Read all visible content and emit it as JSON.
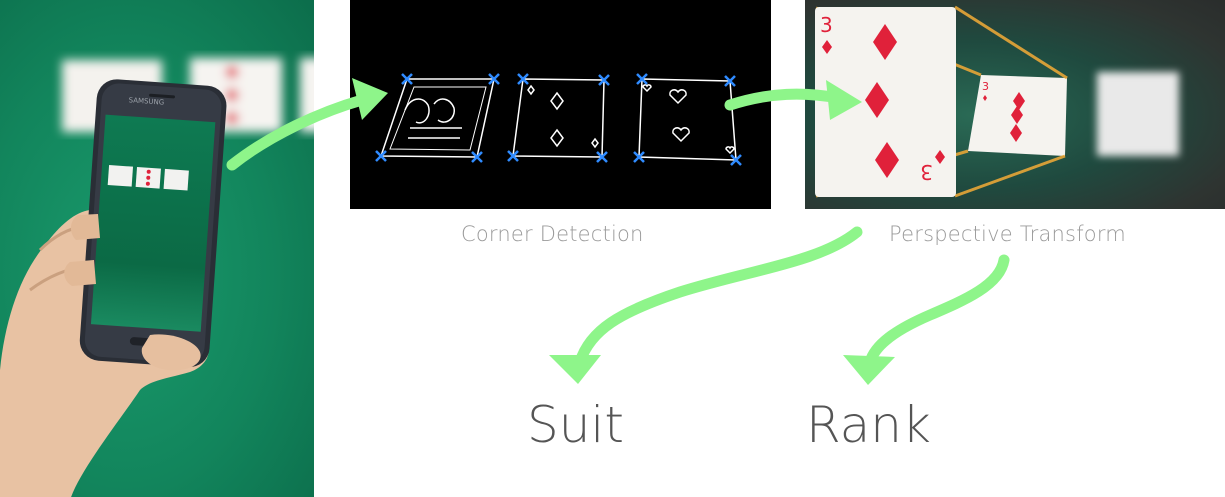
{
  "phone_brand": "SAMSUNG",
  "labels": {
    "corner_detection": "Corner Detection",
    "perspective_transform": "Perspective Transform",
    "suit": "Suit",
    "rank": "Rank"
  },
  "colors": {
    "arrow": "#8ef58a",
    "corner_marker": "#2f8bff",
    "felt": "#12855c",
    "card_red": "#e0213a",
    "projection_line": "#e8a637"
  }
}
